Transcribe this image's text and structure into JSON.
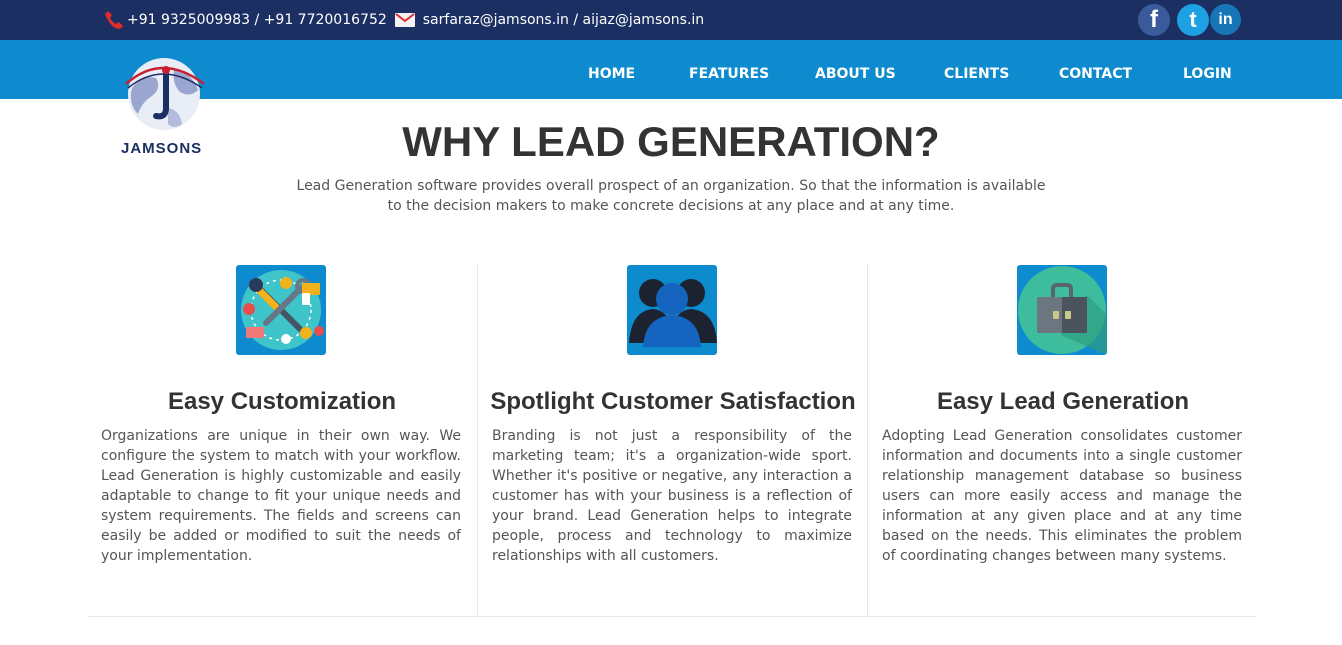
{
  "topbar": {
    "phone_icon": "phone-icon",
    "phones": "+91 9325009983 / +91 7720016752",
    "mail_icon": "mail-icon",
    "emails": "sarfaraz@jamsons.in / aijaz@jamsons.in",
    "social": [
      {
        "name": "facebook-icon",
        "glyph": "f"
      },
      {
        "name": "twitter-icon",
        "glyph": "t"
      },
      {
        "name": "linkedin-icon",
        "glyph": "in"
      }
    ]
  },
  "logo": {
    "brand": "JAMSONS"
  },
  "nav": {
    "items": [
      "HOME",
      "FEATURES",
      "ABOUT US",
      "CLIENTS",
      "CONTACT",
      "LOGIN"
    ]
  },
  "hero": {
    "title": "WHY LEAD GENERATION?",
    "intro": "Lead Generation software provides overall prospect of an organization. So that the information is available to the decision makers to make concrete decisions at any place and at any time."
  },
  "features": [
    {
      "icon": "tools-icon",
      "title": "Easy Customization",
      "text": "Organizations are unique in their own way. We configure the system to match with your workflow. Lead Generation is highly customizable and easily adaptable to change to fit your unique needs and system requirements. The fields and screens can easily be added or modified to suit the needs of your implementation."
    },
    {
      "icon": "customers-icon",
      "title": "Spotlight Customer Satisfaction",
      "text": "Branding is not just a responsibility of the marketing team; it's a organization-wide sport. Whether it's positive or negative, any interaction a customer has with your business is a reflection of your brand. Lead Generation helps to integrate people, process and technology to maximize relationships with all customers."
    },
    {
      "icon": "briefcase-icon",
      "title": "Easy Lead Generation",
      "text": "Adopting Lead Generation consolidates customer information and documents into a single customer relationship management database so business users can more easily access and manage the information at any given place and at any time based on the needs. This eliminates the problem of coordinating changes between many systems."
    }
  ],
  "colors": {
    "topbar_bg": "#1b2f63",
    "navbar_bg": "#0d8bce",
    "heading": "#333333",
    "body_text": "#555555"
  }
}
